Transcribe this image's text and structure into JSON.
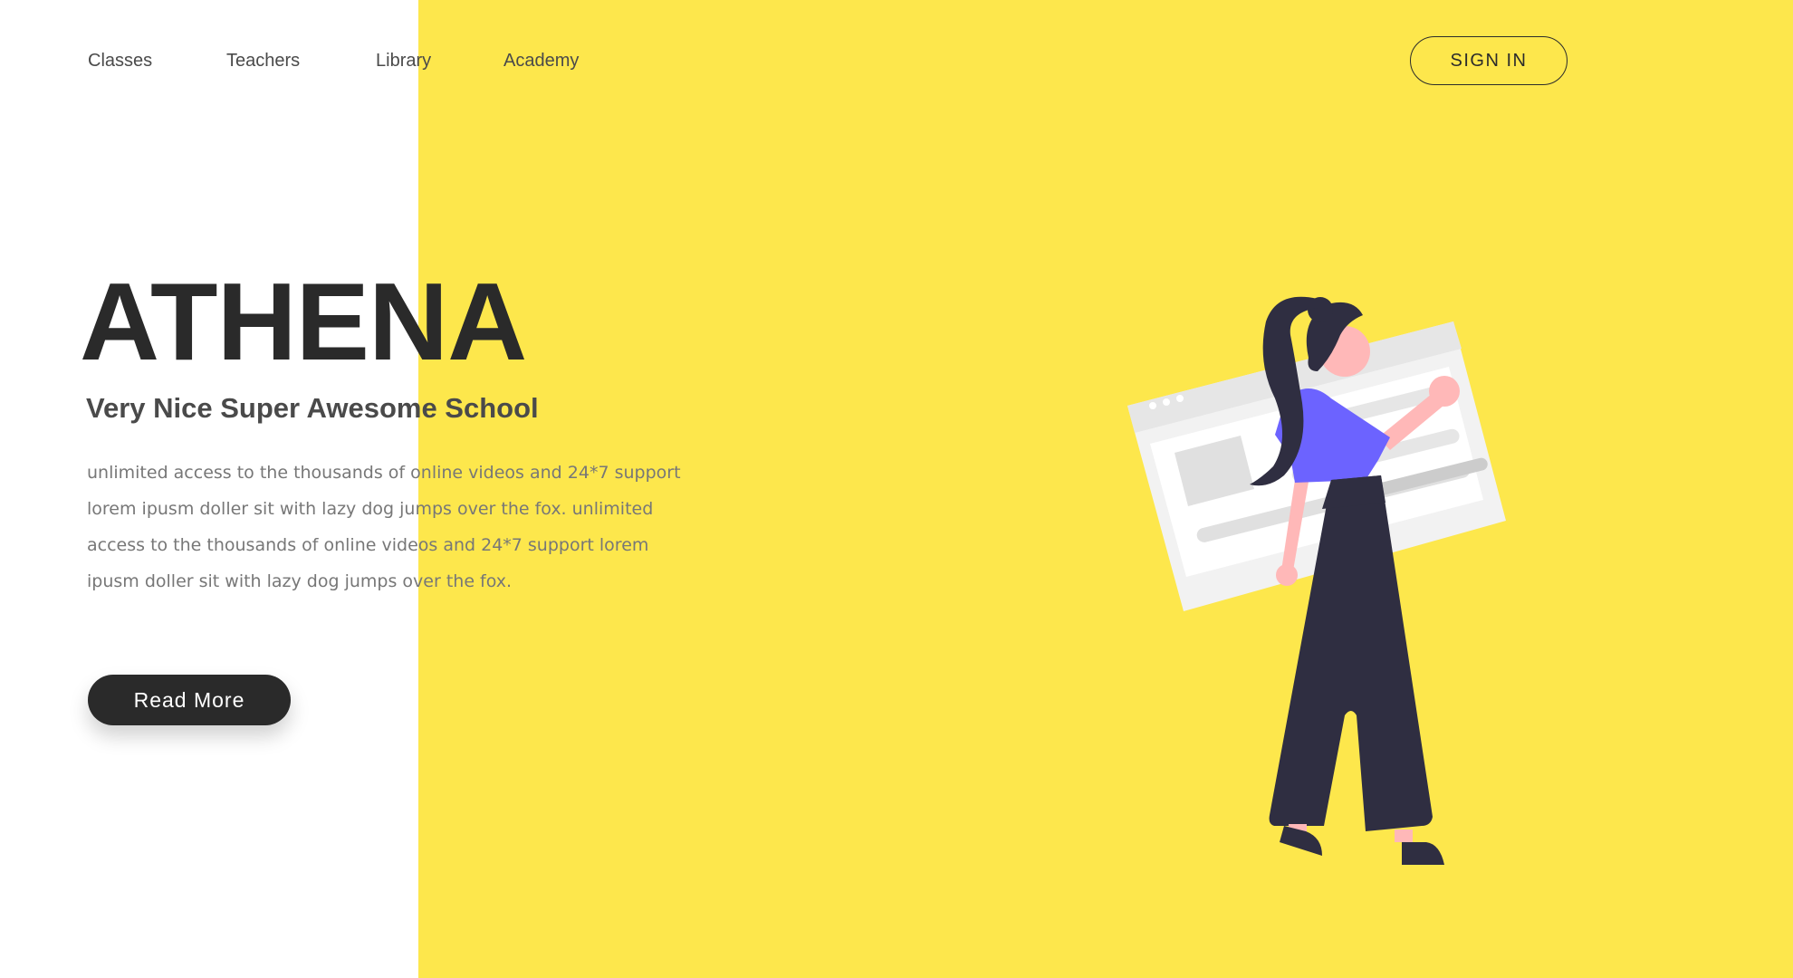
{
  "nav": {
    "items": [
      {
        "label": "Classes"
      },
      {
        "label": "Teachers"
      },
      {
        "label": "Library"
      },
      {
        "label": "Academy"
      }
    ],
    "sign_in_label": "SIGN IN"
  },
  "hero": {
    "title": "ATHENA",
    "subtitle": "Very Nice Super Awesome School",
    "body": "unlimited access to the thousands of online videos and 24*7 support lorem ipusm doller sit with lazy dog jumps over the fox. unlimited access to the thousands of online videos and 24*7 support lorem ipusm doller sit with lazy dog jumps over the fox.",
    "cta_label": "Read More"
  },
  "colors": {
    "accent_yellow": "#fde74c",
    "dark": "#2a2a2a",
    "shirt": "#6c63ff",
    "skin": "#ffb8b8"
  },
  "icons": {
    "illustration": "woman-holding-browser-window-illustration"
  }
}
